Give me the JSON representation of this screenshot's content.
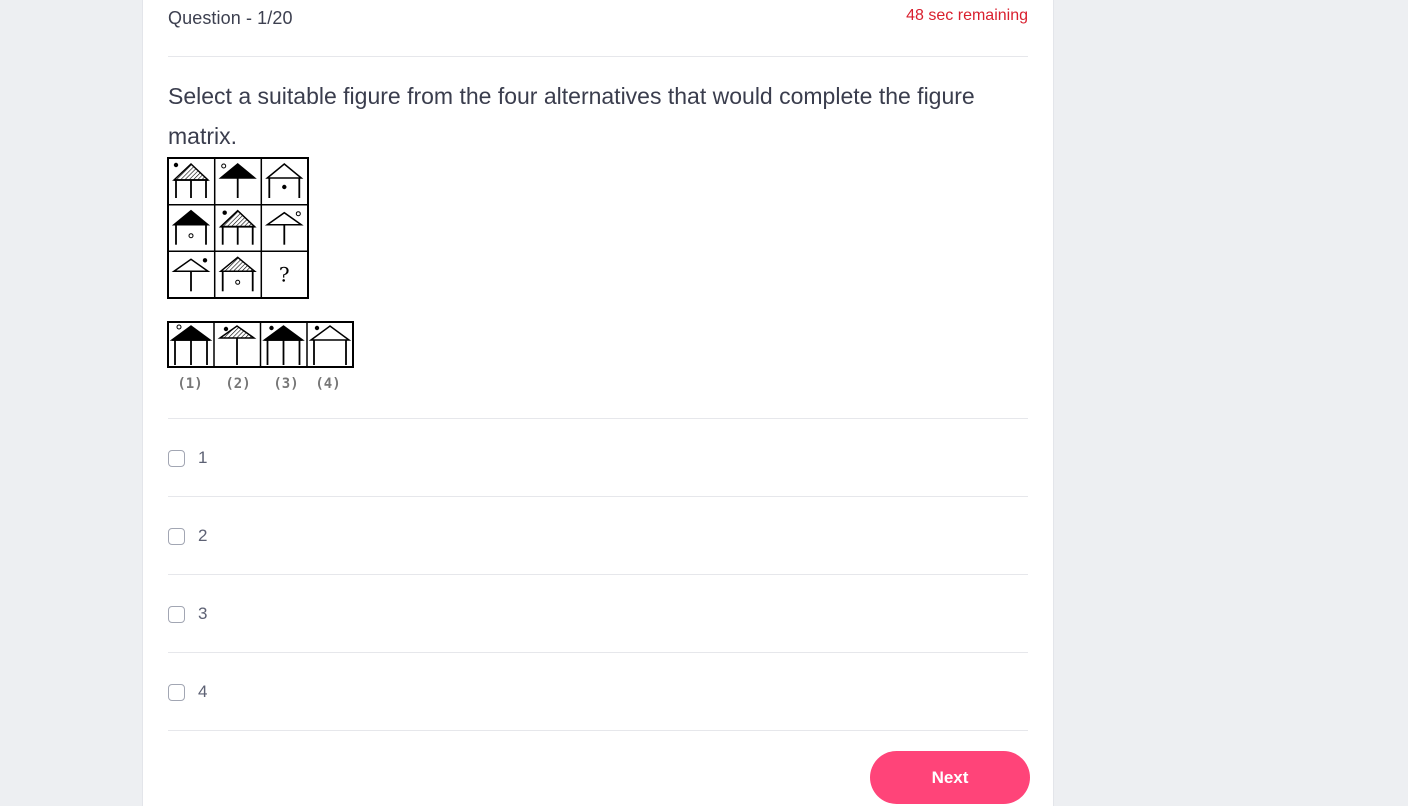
{
  "header": {
    "question_counter": "Question - 1/20",
    "timer": "48 sec remaining"
  },
  "question": {
    "text": "Select a suitable figure from the four alternatives that would complete the figure matrix.",
    "figure_question_mark": "?",
    "answer_figure_labels": [
      "(1)",
      "(2)",
      "(3)",
      "(4)"
    ]
  },
  "options": [
    {
      "label": "1"
    },
    {
      "label": "2"
    },
    {
      "label": "3"
    },
    {
      "label": "4"
    }
  ],
  "actions": {
    "next_label": "Next"
  },
  "colors": {
    "accent": "#ff4479",
    "timer": "#d91f2e",
    "background": "#edeff2"
  }
}
